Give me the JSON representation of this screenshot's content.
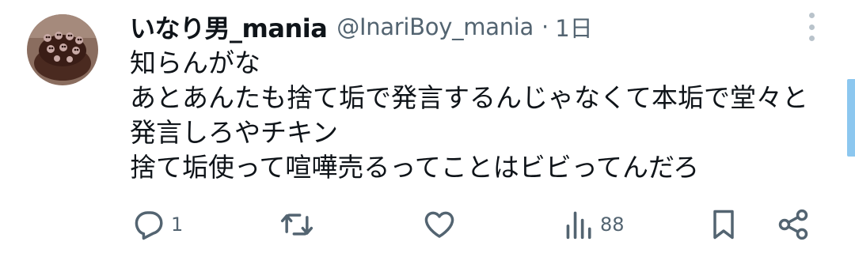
{
  "tweet": {
    "display_name": "いなり男_mania",
    "handle": "@InariBoy_mania",
    "separator": "·",
    "time": "1日",
    "lines": [
      "知らんがな",
      "あとあんたも捨て垢で発言するんじゃなくて本垢で堂々と",
      "発言しろやチキン",
      "捨て垢使って喧嘩売るってことはビビってんだろ"
    ]
  },
  "actions": {
    "reply_count": "1",
    "retweet_count": "",
    "like_count": "",
    "views_count": "88"
  },
  "icons": {
    "avatar": "avatar-image",
    "more": "more-vertical-icon",
    "reply": "reply-icon",
    "retweet": "retweet-icon",
    "like": "heart-icon",
    "views": "views-icon",
    "bookmark": "bookmark-icon",
    "share": "share-icon"
  },
  "colors": {
    "text": "#0f1419",
    "secondary": "#536471",
    "scroll_indicator": "#8cc7ef"
  }
}
